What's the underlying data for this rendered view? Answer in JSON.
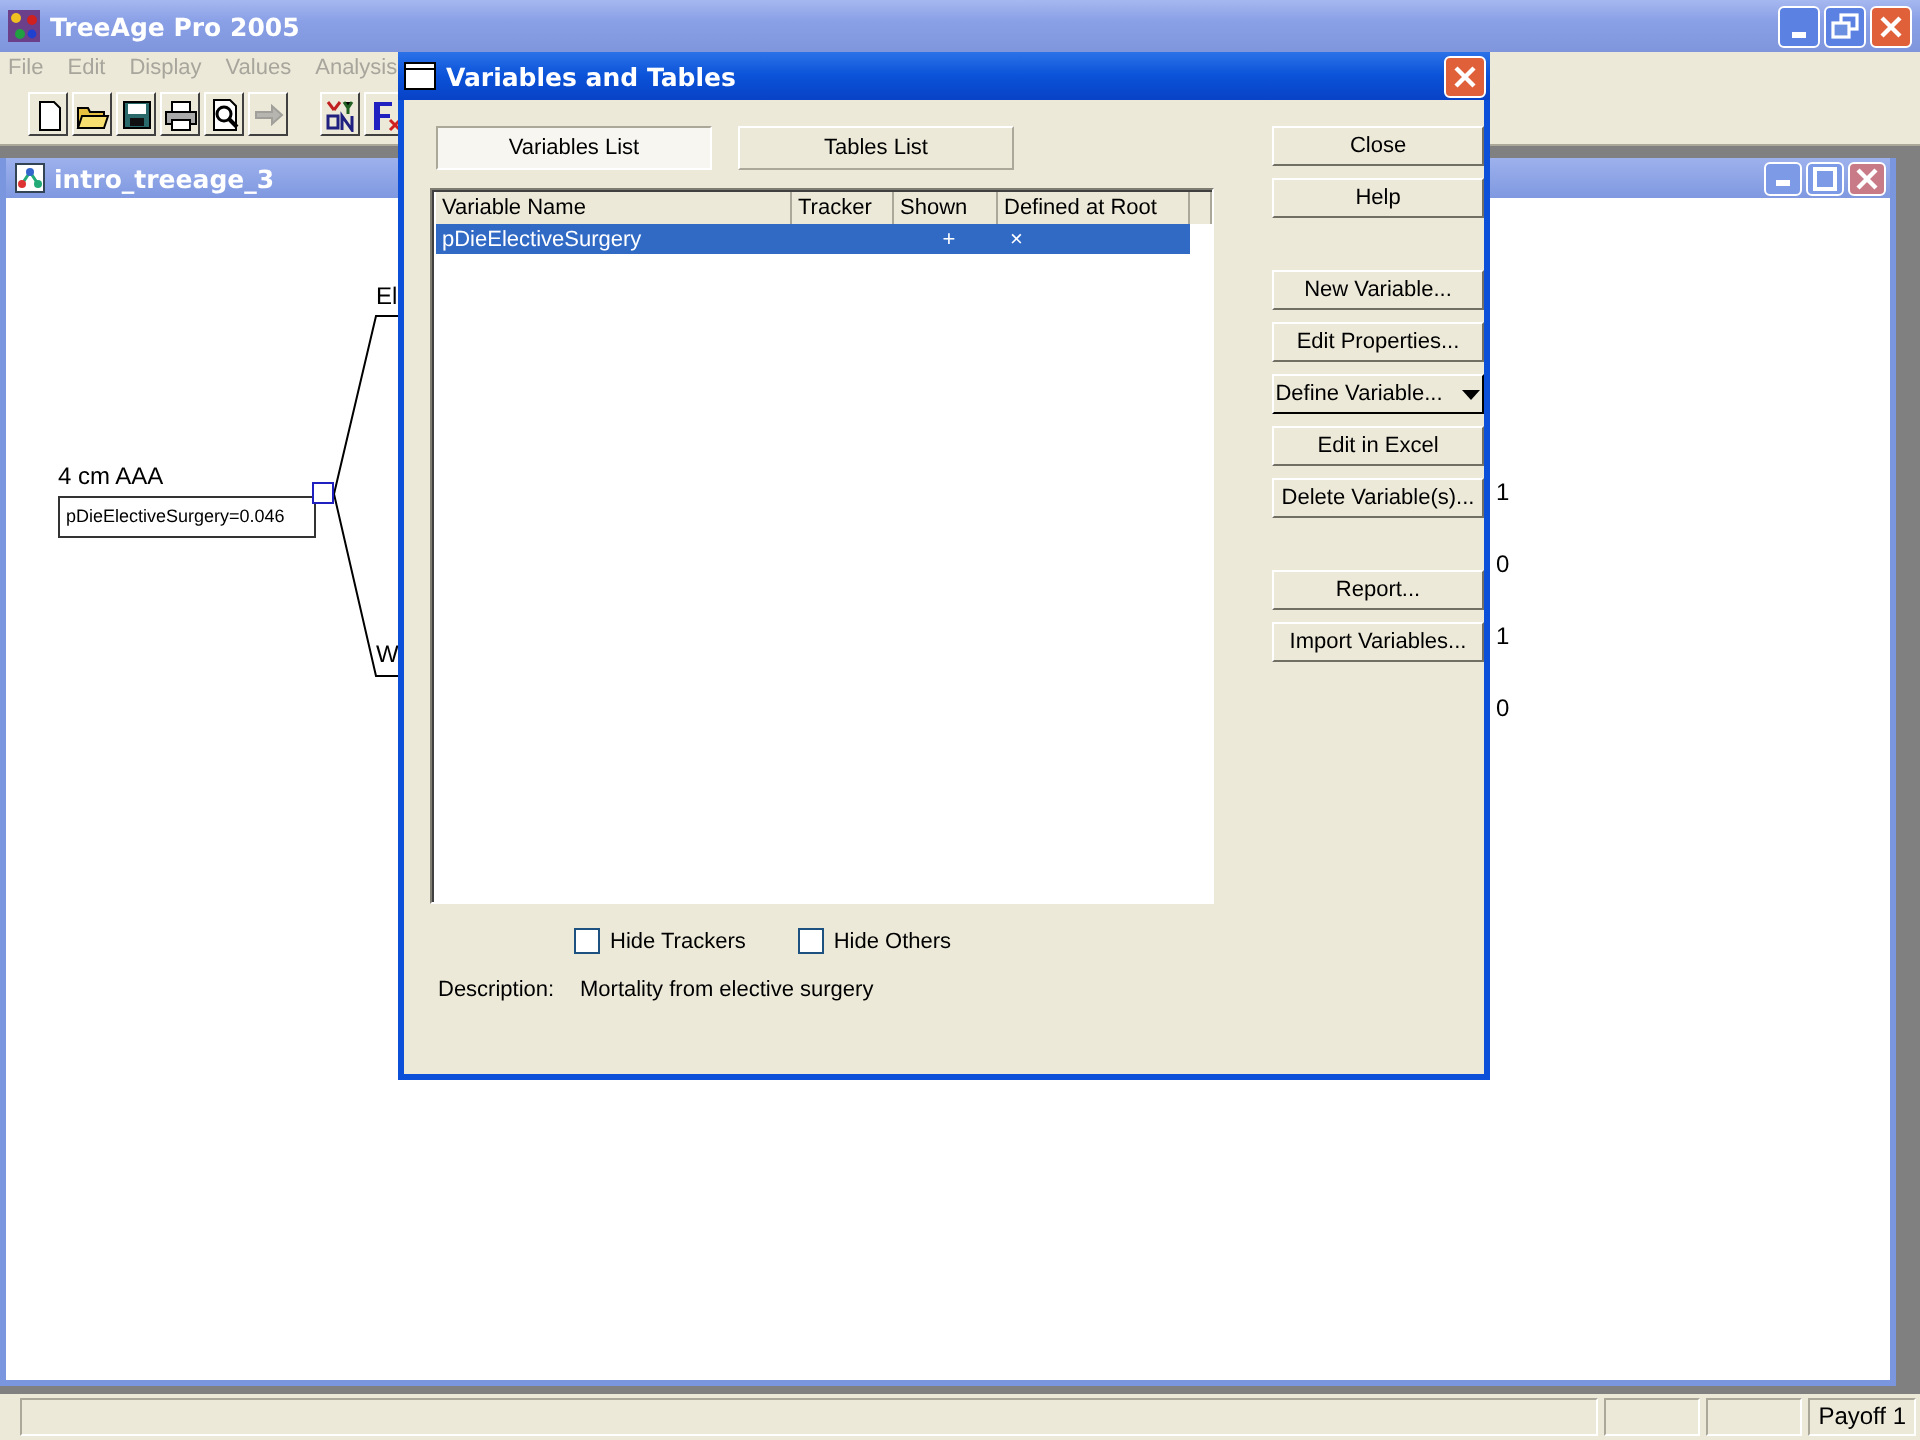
{
  "app": {
    "title": "TreeAge Pro 2005",
    "menu": [
      {
        "label": "File"
      },
      {
        "label": "Edit"
      },
      {
        "label": "Display"
      },
      {
        "label": "Values"
      },
      {
        "label": "Analysis"
      }
    ],
    "toolbar": [
      {
        "disabled": false
      },
      {
        "disabled": false
      },
      {
        "disabled": false
      },
      {
        "disabled": false
      },
      {
        "disabled": false
      },
      {
        "disabled": true
      },
      {
        "disabled": false
      },
      {
        "disabled": false
      }
    ]
  },
  "document": {
    "title": "intro_treeage_3",
    "tree": {
      "root_label": "4 cm AAA",
      "root_definition": "pDieElectiveSurgery=0.046",
      "branches": [
        {
          "label": "El"
        },
        {
          "label": "W"
        }
      ],
      "payoffs": [
        "1",
        "0",
        "1",
        "0"
      ]
    }
  },
  "dialog": {
    "title": "Variables and Tables",
    "tabs": [
      {
        "label": "Variables List",
        "selected": true
      },
      {
        "label": "Tables List",
        "selected": false
      }
    ],
    "columns": [
      "Variable Name",
      "Tracker",
      "Shown",
      "Defined at Root"
    ],
    "rows": [
      {
        "cells": [
          "pDieElectiveSurgery",
          "",
          "+",
          "×"
        ],
        "selected": true
      }
    ],
    "buttons": [
      {
        "label": "Close",
        "kind": "plain"
      },
      {
        "label": "Help",
        "kind": "plain"
      },
      {
        "label": "New Variable...",
        "kind": "plain"
      },
      {
        "label": "Edit Properties...",
        "kind": "plain"
      },
      {
        "label": "Define Variable...",
        "kind": "dropdown"
      },
      {
        "label": "Edit in Excel",
        "kind": "plain"
      },
      {
        "label": "Delete Variable(s)...",
        "kind": "plain"
      },
      {
        "label": "Report...",
        "kind": "plain"
      },
      {
        "label": "Import Variables...",
        "kind": "plain"
      }
    ],
    "checkboxes": [
      {
        "label": "Hide Trackers",
        "checked": false
      },
      {
        "label": "Hide Others",
        "checked": false
      }
    ],
    "description": {
      "label": "Description:",
      "value": "Mortality from elective surgery"
    }
  },
  "status_bar": {
    "payoff": "Payoff 1"
  }
}
